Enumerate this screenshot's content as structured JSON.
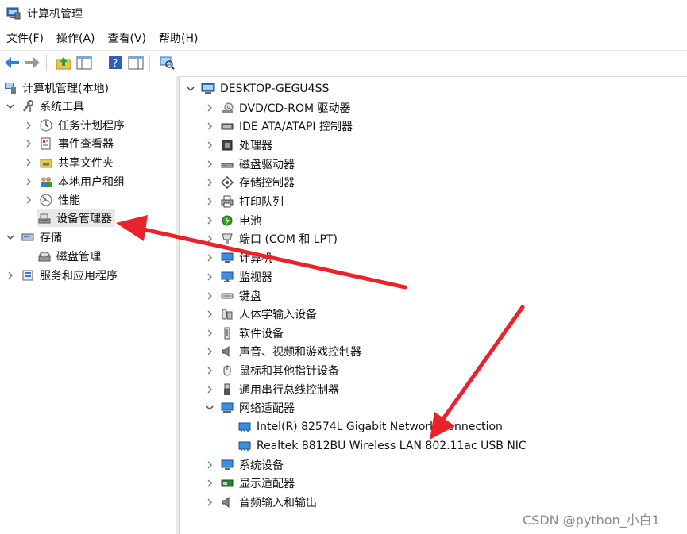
{
  "window": {
    "title": "计算机管理"
  },
  "menu": [
    "文件(F)",
    "操作(A)",
    "查看(V)",
    "帮助(H)"
  ],
  "toolbar": {
    "buttons": [
      "back-icon",
      "forward-icon",
      "up-folder-icon",
      "show-hide-tree-icon",
      "help-icon",
      "properties-icon",
      "scan-hardware-icon"
    ]
  },
  "left_tree": {
    "root": "计算机管理(本地)",
    "system_tools": "系统工具",
    "task_scheduler": "任务计划程序",
    "event_viewer": "事件查看器",
    "shared_folders": "共享文件夹",
    "local_users": "本地用户和组",
    "performance": "性能",
    "device_manager": "设备管理器",
    "storage": "存储",
    "disk_management": "磁盘管理",
    "services": "服务和应用程序"
  },
  "device_tree": {
    "computer_name": "DESKTOP-GEGU4SS",
    "categories": [
      "DVD/CD-ROM 驱动器",
      "IDE ATA/ATAPI 控制器",
      "处理器",
      "磁盘驱动器",
      "存储控制器",
      "打印队列",
      "电池",
      "端口 (COM 和 LPT)",
      "计算机",
      "监视器",
      "键盘",
      "人体学输入设备",
      "软件设备",
      "声音、视频和游戏控制器",
      "鼠标和其他指针设备",
      "通用串行总线控制器",
      "网络适配器",
      "系统设备",
      "显示适配器",
      "音频输入和输出"
    ],
    "network_children": [
      "Intel(R) 82574L Gigabit Network Connection",
      "Realtek 8812BU Wireless LAN 802.11ac USB NIC"
    ]
  },
  "watermark": "CSDN @python_小白1",
  "colors": {
    "arrow": "#e8232b",
    "selection": "#e8e8e8"
  }
}
